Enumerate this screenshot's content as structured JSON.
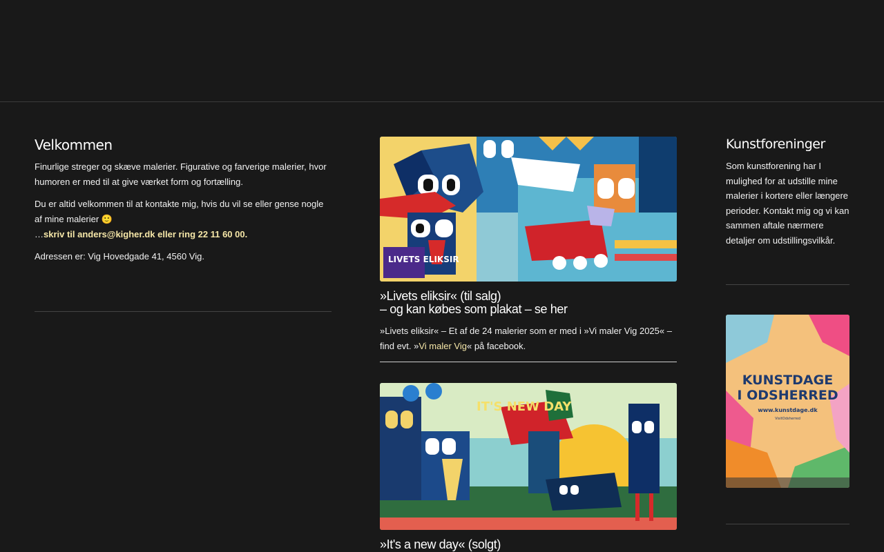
{
  "welcome": {
    "title": "Velkommen",
    "p1": "Finurlige streger og skæve malerier. Figurative og farverige malerier, hvor humoren er med til at give værket form og fortælling.",
    "p2_intro": "Du er altid velkommen til at kontakte mig, hvis du vil se eller gense nogle af mine malerier 🙂",
    "p2_ellipsis": "…",
    "contact": "skriv til anders@kigher.dk eller ring 22 11 60 00.",
    "address": "Adressen er: Vig Hovedgade 41, 4560 Vig."
  },
  "posts": [
    {
      "title_line1": "»Livets eliksir« (til salg)",
      "title_line2": "– og kan købes som plakat – se her",
      "text_before": "»Livets eliksir« – Et af de 24 malerier som er med i »Vi maler Vig 2025« – find evt. »",
      "link": "Vi maler Vig",
      "text_after": "« på facebook.",
      "painting_text": "LIVETS ELIKSIR"
    },
    {
      "title_line1": "»It's a new day« (solgt)",
      "painting_text": "IT'S NEW DAY"
    }
  ],
  "sidebar": {
    "title": "Kunstforeninger",
    "text": "Som kunstforening har I mulighed for at udstille mine malerier i kortere eller længere perioder. Kontakt mig og vi kan sammen aftale nærmere detaljer om udstillingsvilkår.",
    "poster": {
      "line1": "KUNSTDAGE",
      "line2": "I ODSHERRED",
      "url": "www.kunstdage.dk",
      "brand": "VisitOdsherred"
    }
  },
  "colors": {
    "background": "#191919",
    "highlight": "#f6e7a8"
  }
}
